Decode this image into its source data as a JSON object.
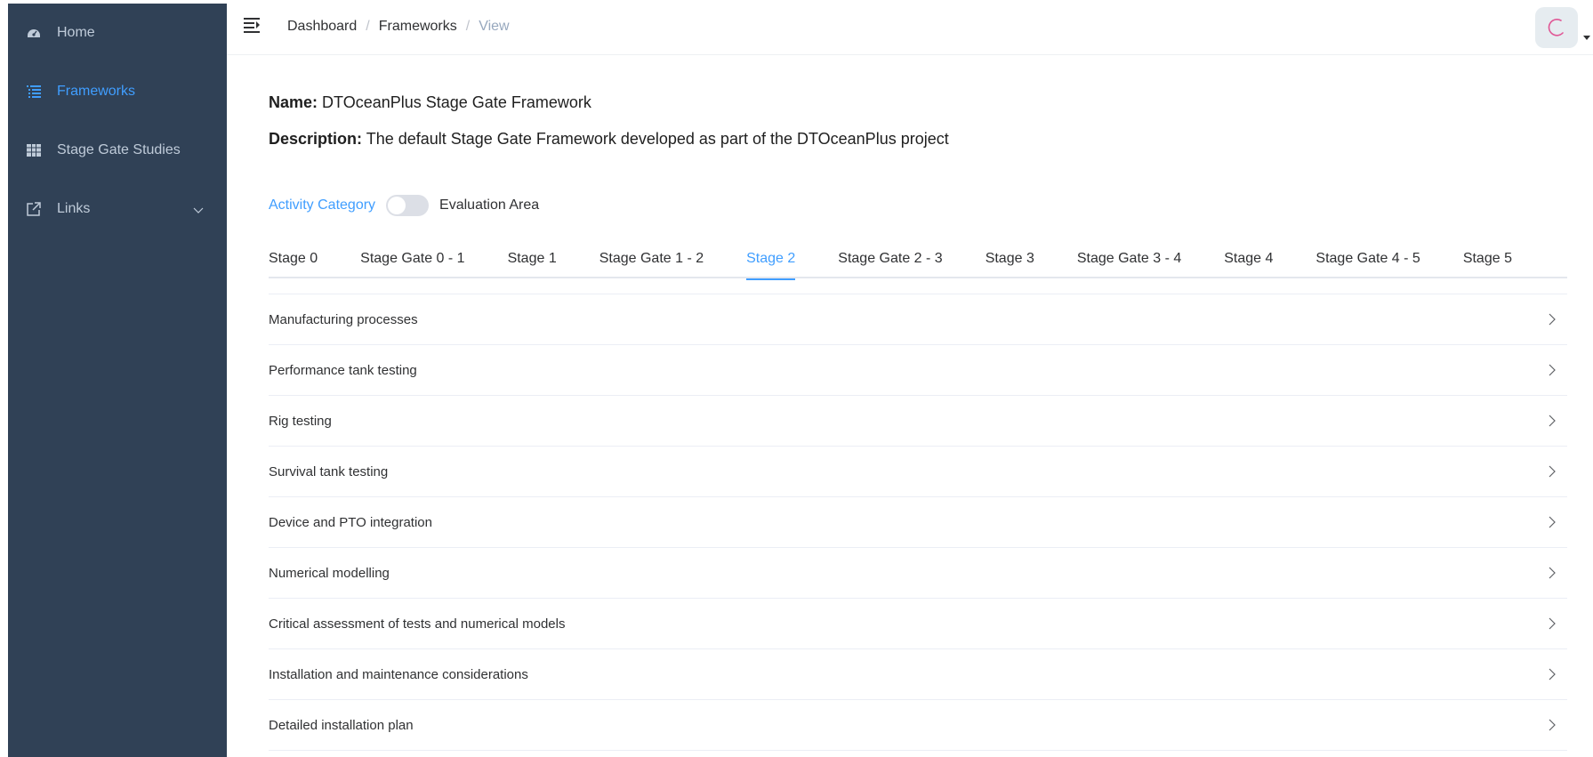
{
  "sidebar": {
    "items": [
      {
        "label": "Home",
        "icon": "dashboard-icon"
      },
      {
        "label": "Frameworks",
        "icon": "list-icon",
        "active": true
      },
      {
        "label": "Stage Gate Studies",
        "icon": "table-icon"
      },
      {
        "label": "Links",
        "icon": "external-link-icon"
      }
    ]
  },
  "breadcrumb": {
    "items": [
      "Dashboard",
      "Frameworks"
    ],
    "separator": "/",
    "current": "View"
  },
  "framework": {
    "name_label": "Name:",
    "name": "DTOceanPlus Stage Gate Framework",
    "description_label": "Description:",
    "description": "The default Stage Gate Framework developed as part of the DTOceanPlus project"
  },
  "toggle": {
    "left_label": "Activity Category",
    "right_label": "Evaluation Area"
  },
  "tabs": [
    "Stage 0",
    "Stage Gate 0 - 1",
    "Stage 1",
    "Stage Gate 1 - 2",
    "Stage 2",
    "Stage Gate 2 - 3",
    "Stage 3",
    "Stage Gate 3 - 4",
    "Stage 4",
    "Stage Gate 4 - 5",
    "Stage 5"
  ],
  "active_tab": "Stage 2",
  "activities": [
    "Manufacturing processes",
    "Performance tank testing",
    "Rig testing",
    "Survival tank testing",
    "Device and PTO integration",
    "Numerical modelling",
    "Critical assessment of tests and numerical models",
    "Installation and maintenance considerations",
    "Detailed installation plan"
  ],
  "colors": {
    "sidebar_bg": "#304156",
    "sidebar_text": "#bfcbd9",
    "accent": "#409eff"
  }
}
